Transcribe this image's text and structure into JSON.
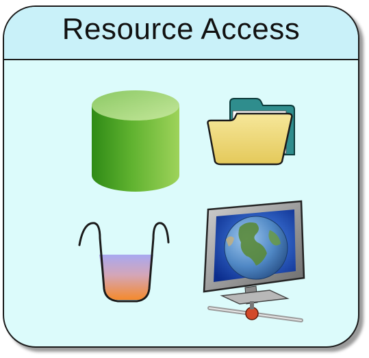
{
  "panel": {
    "title": "Resource Access",
    "colors": {
      "header_fill": "#c9f1f9",
      "body_fill": "#dcfbfb",
      "border": "#1a1a1a"
    }
  },
  "icons": [
    {
      "name": "database-icon",
      "color": "#6cbc3a"
    },
    {
      "name": "folder-icon",
      "color": "#f0dc78"
    },
    {
      "name": "beaker-icon",
      "color": "#f0a050"
    },
    {
      "name": "computer-monitor-icon",
      "color": "#2c6fd6"
    }
  ]
}
